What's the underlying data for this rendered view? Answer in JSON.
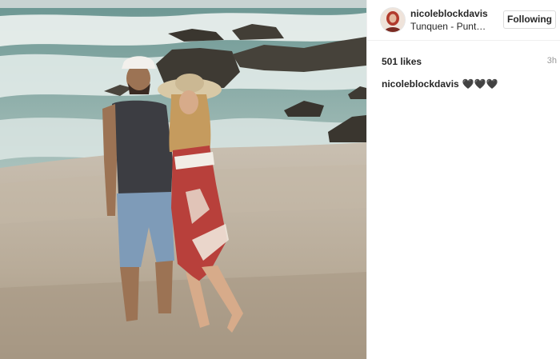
{
  "photo": {
    "description_icon": "beach-photo",
    "colors": {
      "sea": "#7ea8a6",
      "foam": "#eef3f1",
      "sand": "#bcae9c",
      "rock": "#3e3a33"
    }
  },
  "post": {
    "username": "nicoleblockdavis",
    "location": "Tunquen - Punta ...",
    "follow_label": "Following",
    "likes": "501 likes",
    "time": "3h",
    "caption_user": "nicoleblockdavis",
    "caption_text": "🖤🖤🖤"
  }
}
